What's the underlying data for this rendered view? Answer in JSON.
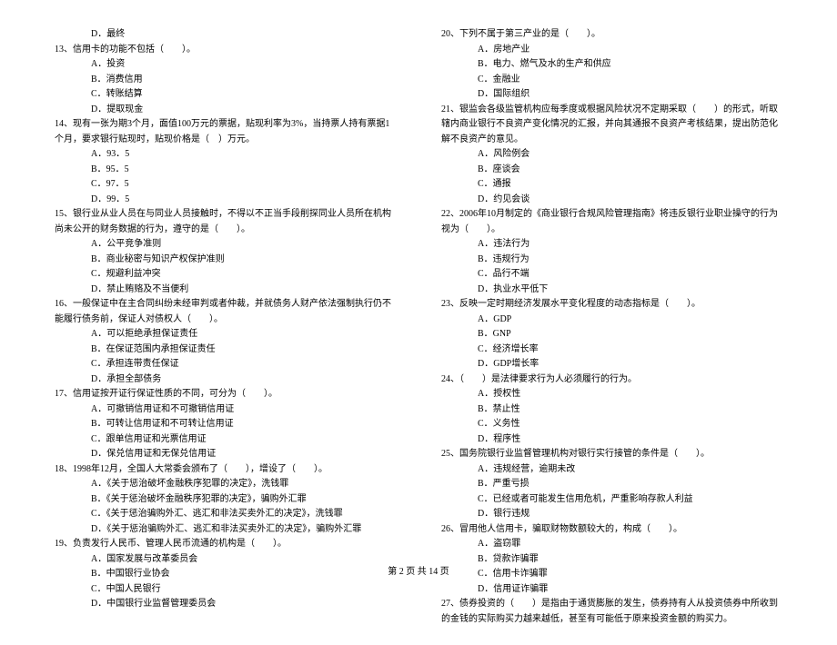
{
  "left": {
    "q12_optD": "D．最终",
    "q13": "13、信用卡的功能不包括（　　）。",
    "q13_A": "A．投资",
    "q13_B": "B．消费信用",
    "q13_C": "C．转账结算",
    "q13_D": "D．提取现金",
    "q14": "14、现有一张为期3个月，面值100万元的票据，贴现利率为3%，当持票人持有票据1个月，要求银行贴现时，贴现价格是（　）万元。",
    "q14_A": "A．93．5",
    "q14_B": "B．95．5",
    "q14_C": "C．97．5",
    "q14_D": "D．99．5",
    "q15": "15、银行业从业人员在与同业人员接触时，不得以不正当手段削探同业人员所在机构尚未公开的财务数据的行为，遵守的是（　　）。",
    "q15_A": "A．公平竞争准则",
    "q15_B": "B．商业秘密与知识产权保护准则",
    "q15_C": "C．规避利益冲突",
    "q15_D": "D．禁止贿赂及不当便利",
    "q16": "16、一般保证中在主合同纠纷未经审判或者仲裁，并就债务人财产依法强制执行仍不能履行债务前，保证人对债权人（　　）。",
    "q16_A": "A．可以拒绝承担保证责任",
    "q16_B": "B．在保证范围内承担保证责任",
    "q16_C": "C．承担连带责任保证",
    "q16_D": "D．承担全部债务",
    "q17": "17、信用证按开证行保证性质的不同，可分为（　　）。",
    "q17_A": "A．可撤销信用证和不可撤销信用证",
    "q17_B": "B．可转让信用证和不可转让信用证",
    "q17_C": "C．跟单信用证和光票信用证",
    "q17_D": "D．保兑信用证和无保兑信用证",
    "q18": "18、1998年12月，全国人大常委会颁布了（　　），增设了（　　）。",
    "q18_A": "A．《关于惩治破坏金融秩序犯罪的决定》，洗钱罪",
    "q18_B": "B．《关于惩治破坏金融秩序犯罪的决定》，骗购外汇罪",
    "q18_C": "C．《关于惩治骗购外汇、逃汇和非法买卖外汇的决定》，洗钱罪",
    "q18_D": "D．《关于惩治骗购外汇、逃汇和非法买卖外汇的决定》，骗购外汇罪",
    "q19": "19、负责发行人民币、管理人民币流通的机构是（　　）。",
    "q19_A": "A．国家发展与改革委员会",
    "q19_B": "B．中国银行业协会",
    "q19_C": "C．中国人民银行",
    "q19_D": "D．中国银行业监督管理委员会"
  },
  "right": {
    "q20": "20、下列不属于第三产业的是（　　）。",
    "q20_A": "A．房地产业",
    "q20_B": "B．电力、燃气及水的生产和供应",
    "q20_C": "C．金融业",
    "q20_D": "D．国际组织",
    "q21": "21、银监会各级监管机构应每季度或根据风险状况不定期采取（　　）的形式，听取辖内商业银行不良资产变化情况的汇报，并向其通报不良资产考核结果，提出防范化解不良资产的意见。",
    "q21_A": "A．风险例会",
    "q21_B": "B．座谈会",
    "q21_C": "C．通报",
    "q21_D": "D．约见会谈",
    "q22": "22、2006年10月制定的《商业银行合规风险管理指南》将违反银行业职业操守的行为视为（　　）。",
    "q22_A": "A．违法行为",
    "q22_B": "B．违规行为",
    "q22_C": "C．品行不端",
    "q22_D": "D．执业水平低下",
    "q23": "23、反映一定时期经济发展水平变化程度的动态指标是（　　）。",
    "q23_A": "A．GDP",
    "q23_B": "B．GNP",
    "q23_C": "C．经济增长率",
    "q23_D": "D．GDP增长率",
    "q24": "24、（　　）是法律要求行为人必须履行的行为。",
    "q24_A": "A．授权性",
    "q24_B": "B．禁止性",
    "q24_C": "C．义务性",
    "q24_D": "D．程序性",
    "q25": "25、国务院银行业监督管理机构对银行实行接管的条件是（　　）。",
    "q25_A": "A．违规经营，逾期未改",
    "q25_B": "B．严重亏损",
    "q25_C": "C．已经或者可能发生信用危机，严重影响存款人利益",
    "q25_D": "D．银行违规",
    "q26": "26、冒用他人信用卡，骗取财物数额较大的，构成（　　）。",
    "q26_A": "A．盗窃罪",
    "q26_B": "B．贷款诈骗罪",
    "q26_C": "C．信用卡诈骗罪",
    "q26_D": "D．信用证诈骗罪",
    "q27": "27、债券投资的（　　）是指由于通货膨胀的发生，债券持有人从投资债券中所收到的金钱的实际购买力越来越低，甚至有可能低于原来投资金额的购买力。"
  },
  "footer": "第 2 页 共 14 页"
}
